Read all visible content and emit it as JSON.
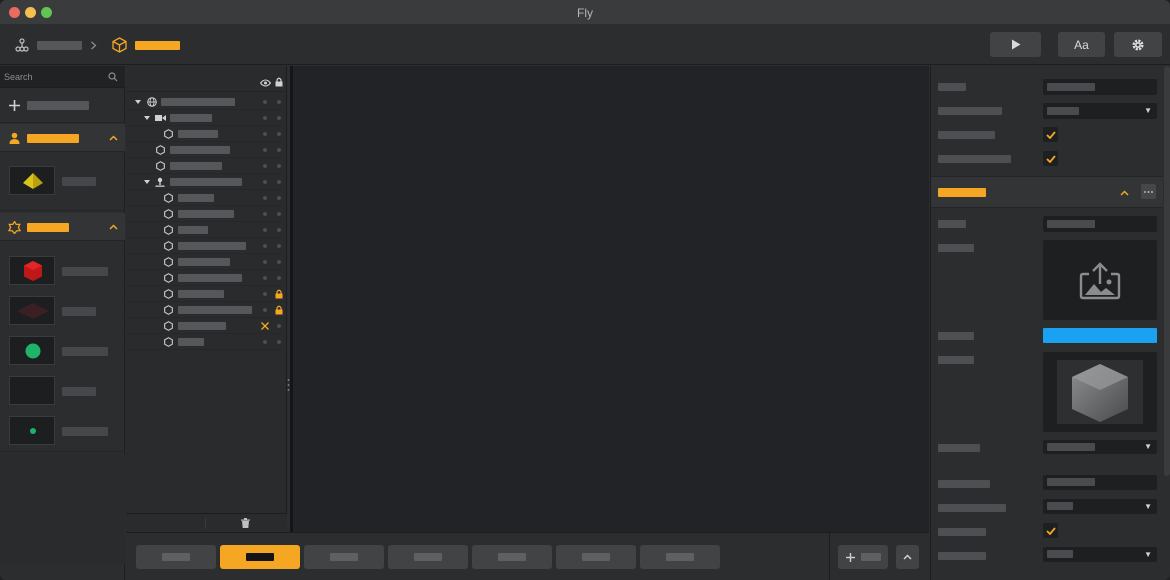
{
  "window": {
    "title": "Fly"
  },
  "toolbar": {
    "font_button_label": "Aa",
    "icons": [
      "hierarchy-icon",
      "chevron-right-icon",
      "cube-icon",
      "play-icon",
      "gear-icon"
    ]
  },
  "sidebar": {
    "search_placeholder": "Search",
    "icons": [
      "search-icon",
      "plus-icon",
      "user-icon",
      "chevron-up-icon",
      "badge-icon"
    ]
  },
  "hierarchy": {
    "icons": [
      "eye-icon",
      "lock-icon",
      "globe-icon",
      "camera-icon",
      "light-icon",
      "node-icon",
      "trash-icon"
    ]
  },
  "inspector": {
    "color_swatch": "#1ba1f2",
    "icons": [
      "check-icon",
      "upload-image-icon",
      "more-icon"
    ]
  },
  "colors": {
    "accent": "#f5a623",
    "panel": "#2c2d2f",
    "viewport": "#222326",
    "swatch_blue": "#1ba1f2"
  }
}
